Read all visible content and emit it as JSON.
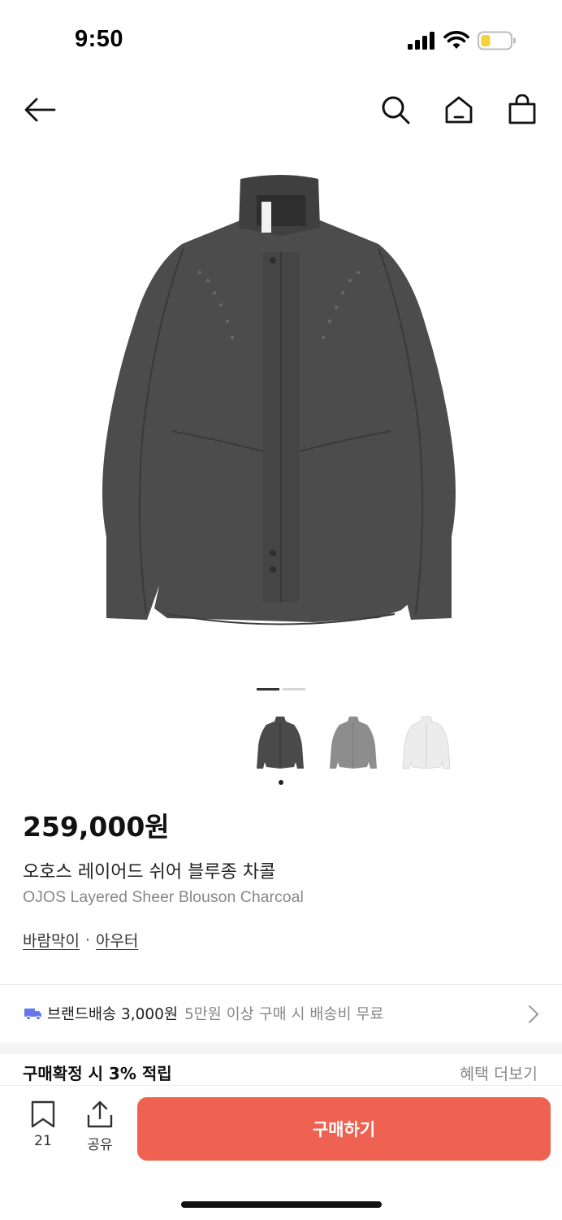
{
  "status": {
    "time": "9:50"
  },
  "nav": {
    "icons": [
      "back-arrow-icon",
      "search-icon",
      "home-icon",
      "shopping-bag-icon"
    ]
  },
  "gallery": {
    "current_index": 0,
    "total": 2,
    "variant_colors": [
      "#4a4a4a",
      "#8d8d8d",
      "#ececec"
    ]
  },
  "product": {
    "price": "259,000원",
    "name_ko": "오호스 레이어드 쉬어 블루종 차콜",
    "name_en": "OJOS Layered Sheer Blouson Charcoal",
    "categories": [
      "바람막이",
      "아우터"
    ]
  },
  "shipping": {
    "brand_fee": "브랜드배송 3,000원",
    "note": "5만원 이상 구매 시 배송비 무료"
  },
  "points": {
    "label": "구매확정 시 3% 적립",
    "more": "혜택 더보기"
  },
  "bottom": {
    "wishlist_count": "21",
    "share_label": "공유",
    "buy_label": "구매하기"
  },
  "colors": {
    "accent": "#ef6252",
    "truck": "#6675f0",
    "battery": "#f3d23a"
  }
}
